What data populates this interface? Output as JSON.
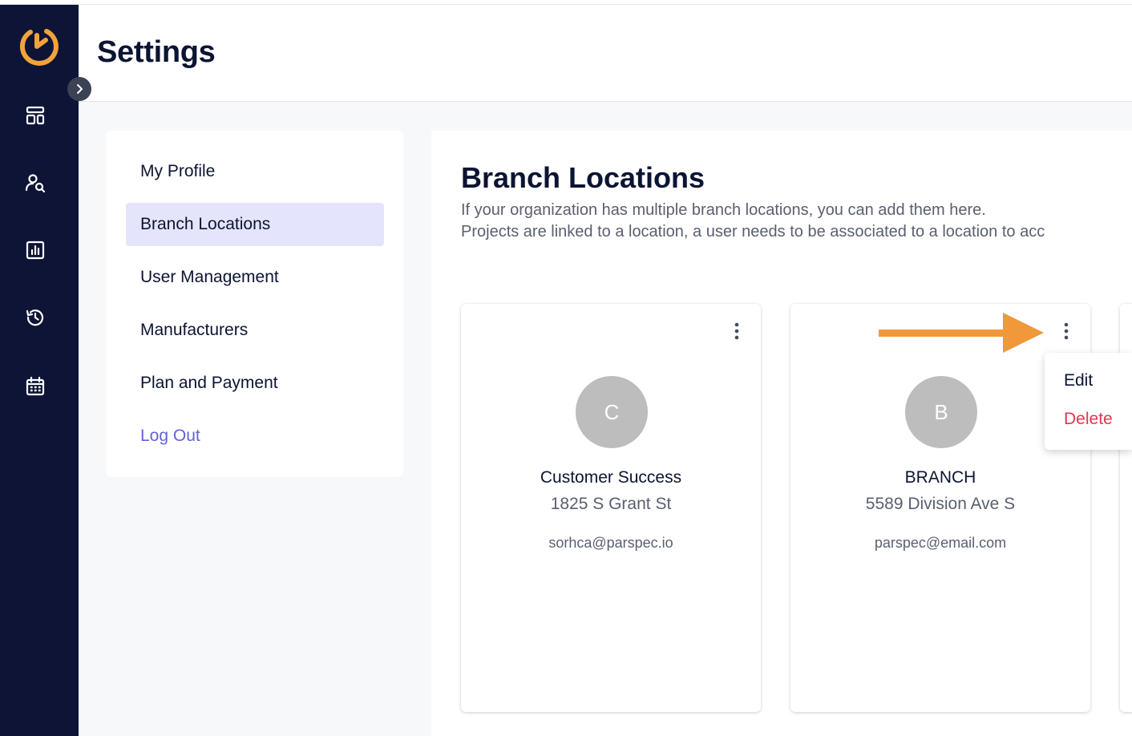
{
  "header": {
    "title": "Settings"
  },
  "rail": {
    "icons": [
      "dashboard-icon",
      "user-search-icon",
      "reports-icon",
      "history-icon",
      "calendar-icon"
    ],
    "accent": "#f2a33a",
    "background": "#0e1436"
  },
  "menu": {
    "items": [
      {
        "label": "My Profile",
        "active": false
      },
      {
        "label": "Branch Locations",
        "active": true
      },
      {
        "label": "User Management",
        "active": false
      },
      {
        "label": "Manufacturers",
        "active": false
      },
      {
        "label": "Plan and Payment",
        "active": false
      },
      {
        "label": "Log Out",
        "active": false
      }
    ],
    "active_color": "#e4e4fc",
    "logout_color": "#6461dc"
  },
  "main": {
    "title": "Branch Locations",
    "description_line1": "If your organization has multiple branch locations, you can add them here.",
    "description_line2": "Projects are linked to a location, a user needs to be associated to a location to acc"
  },
  "cards": [
    {
      "initial": "C",
      "name": "Customer Success",
      "address": "1825 S Grant St",
      "email": "sorhca@parspec.io"
    },
    {
      "initial": "B",
      "name": "BRANCH",
      "address": "5589 Division Ave S",
      "email": "parspec@email.com"
    }
  ],
  "dropdown": {
    "edit_label": "Edit",
    "delete_label": "Delete",
    "delete_color": "#e0374e"
  },
  "annotation": {
    "arrow_color": "#f0983a"
  }
}
